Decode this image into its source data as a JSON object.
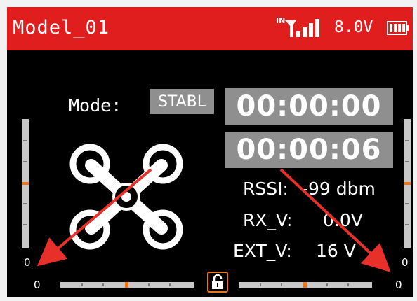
{
  "header": {
    "model_name": "Model_01",
    "signal_prefix": "IN",
    "voltage": "8.0V",
    "icons": [
      "signal-strength-icon",
      "battery-icon"
    ],
    "color": "#e01e1e"
  },
  "flight": {
    "mode_label": "Mode:",
    "mode_value": "STABL",
    "timer_1": "00:00:00",
    "timer_2": "00:00:06"
  },
  "telemetry": {
    "rssi_label": "RSSI:",
    "rssi_value": "-99 dbm",
    "rx_v_label": "RX_V:",
    "rx_v_value": "0.0V",
    "ext_v_label": "EXT_V:",
    "ext_v_value": "16 V"
  },
  "trims": {
    "left_vertical": "0",
    "left_horizontal": "0",
    "right_horizontal": "0",
    "right_vertical": "0"
  },
  "icons": {
    "drone": "quadcopter-icon",
    "lock": "unlock-icon"
  }
}
